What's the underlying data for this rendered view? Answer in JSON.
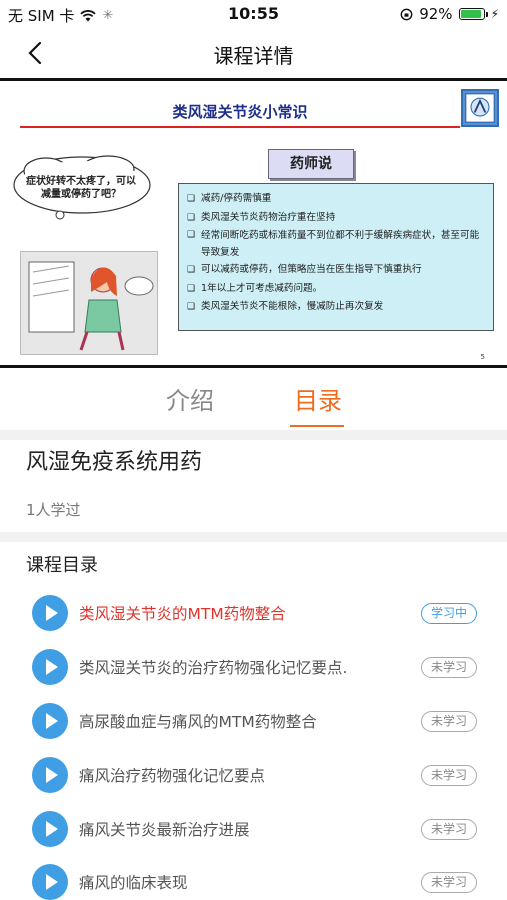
{
  "status_bar": {
    "carrier": "无 SIM 卡",
    "time": "10:55",
    "battery": "92%",
    "battery_level": 0.92
  },
  "nav": {
    "title": "课程详情"
  },
  "slide": {
    "title": "类风湿关节炎小常识",
    "callout": "药师说",
    "cloud_text": "症状好转不太疼了，可以减量或停药了吧？",
    "bullets": [
      "减药/停药需慎重",
      "类风湿关节炎药物治疗重在坚持",
      "经常间断吃药或标准药量不到位都不利于缓解疾病症状，甚至可能导致复发",
      "可以减药或停药，但策略应当在医生指导下慎重执行",
      "1年以上才可考虑减药问题。",
      "类风湿关节炎不能根除，慢减防止再次复发"
    ],
    "page": "5"
  },
  "tabs": [
    {
      "label": "介绍"
    },
    {
      "label": "目录"
    }
  ],
  "course": {
    "title": "风湿免疫系统用药",
    "learners": "1人学过"
  },
  "catalog": {
    "heading": "课程目录",
    "lessons": [
      {
        "title": "类风湿关节炎的MTM药物整合",
        "status": "学习中"
      },
      {
        "title": "类风湿关节炎的治疗药物强化记忆要点.",
        "status": "未学习"
      },
      {
        "title": "高尿酸血症与痛风的MTM药物整合",
        "status": "未学习"
      },
      {
        "title": "痛风治疗药物强化记忆要点",
        "status": "未学习"
      },
      {
        "title": "痛风关节炎最新治疗进展",
        "status": "未学习"
      },
      {
        "title": "痛风的临床表现",
        "status": "未学习"
      }
    ]
  },
  "colors": {
    "accent": "#ec6d1f",
    "play_blue": "#3f9ee4",
    "active_red": "#e2332b"
  }
}
